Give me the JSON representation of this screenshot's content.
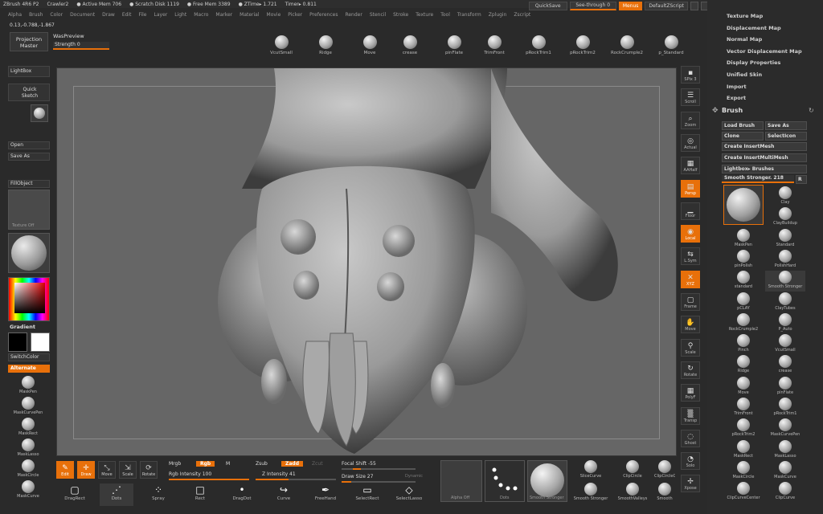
{
  "titlebar": {
    "app": "ZBrush 4R6 P2",
    "doc": "Crawler2",
    "mem": "● Active Mem 706",
    "scratch": "● Scratch Disk 1119",
    "free": "● Free Mem 3389",
    "ztimer": "● ZTime▸ 1.721",
    "timer": "Timer▸ 0.811"
  },
  "menus": [
    "Alpha",
    "Brush",
    "Color",
    "Document",
    "Draw",
    "Edit",
    "File",
    "Layer",
    "Light",
    "Macro",
    "Marker",
    "Material",
    "Movie",
    "Picker",
    "Preferences",
    "Render",
    "Stencil",
    "Stroke",
    "Texture",
    "Tool",
    "Transform",
    "Zplugin",
    "Zscript"
  ],
  "topright": {
    "quicksave": "QuickSave",
    "seethrough": "See-through",
    "seethrough_val": "0",
    "menus": "Menus",
    "script": "DefaultZScript"
  },
  "coords": "0.13,-0.788,-1.867",
  "projection": {
    "line1": "Projection",
    "line2": "Master"
  },
  "waspreview": "WasPreview",
  "strength": {
    "label": "Strength",
    "value": "0",
    "level": 0
  },
  "shelf": [
    "VcutSmall",
    "Ridge",
    "Move",
    "crease",
    "pinFlate",
    "TrimFront",
    "pRockTrim1",
    "pRockTrim2",
    "RockCrumple2",
    "p_Standard"
  ],
  "left": {
    "lightbox": "LightBox",
    "quicksketch1": "Quick",
    "quicksketch2": "Sketch",
    "open": "Open",
    "saveas": "Save As",
    "fillobject": "FillObject",
    "texture": "Texture Off",
    "gradient": "Gradient",
    "switchcolor": "SwitchColor",
    "alternate": "Alternate",
    "alphas": [
      "MaskPen",
      "MaskCurvePen",
      "MaskRect",
      "MaskLasso",
      "MaskCircle",
      "MaskCurve"
    ]
  },
  "rightshelf": [
    "SPix 3",
    "Scroll",
    "Zoom",
    "Actual",
    "AAHalf",
    "Persp",
    "Floor",
    "Local",
    "L.Sym",
    "XYZ",
    "Frame",
    "Move",
    "Scale",
    "Rotate",
    "PolyF",
    "Transp",
    "Ghost",
    "Solo",
    "Xpose"
  ],
  "rightshelf_spix_val": "3",
  "tray": {
    "menu": [
      "Texture Map",
      "Displacement Map",
      "Normal Map",
      "Vector Displacement Map",
      "Display Properties",
      "Unified Skin",
      "Import",
      "Export"
    ],
    "brush_title": "Brush",
    "load": "Load Brush",
    "save": "Save As",
    "clone": "Clone",
    "selecticon": "SelectIcon",
    "insertmesh": "Create InsertMesh",
    "insertmulti": "Create InsertMultiMesh",
    "lightboxbrushes": "Lightbox▸ Brushes",
    "current": "Smooth Stronger. 218",
    "current_r": "R",
    "brushes": [
      "Clay",
      "ClayBuildup",
      "MaskPen",
      "Standard",
      "pinPolish",
      "PolishHard",
      "standard",
      "Smooth Stronger",
      "pCLAY",
      "ClayTubes",
      "RockCrumple2",
      "P_Auto",
      "Pinch",
      "VcutSmall",
      "Ridge",
      "crease",
      "Move",
      "pinFlate",
      "TrimFront",
      "pRockTrim1",
      "pRockTrim2",
      "MaskCurvePen",
      "MaskRect",
      "MaskLasso",
      "MaskCircle",
      "MaskCurve",
      "ClipCurveCenter",
      "ClipCurve"
    ]
  },
  "bottom": {
    "edit": "Edit",
    "draw": "Draw",
    "move": "Move",
    "scale": "Scale",
    "rotate": "Rotate",
    "mrgb": "Mrgb",
    "rgb": "Rgb",
    "m": "M",
    "rgb_intensity": "Rgb Intensity 100",
    "rgb_intensity_level": 1.0,
    "zsub": "Zsub",
    "zadd": "Zadd",
    "zcut": "Zcut",
    "z_intensity": "Z Intensity 41",
    "z_intensity_level": 0.41,
    "focal": "Focal Shift -55",
    "drawsize": "Draw Size 27",
    "dynamic": "Dynamic",
    "alpha_off": "Alpha Off",
    "texture_label": "Dots",
    "material_label": "Smooth Stronger",
    "strokes": [
      "DragRect",
      "Dots",
      "Spray",
      "Rect",
      "DragDot",
      "Curve",
      "FreeHand",
      "SelectRect",
      "SelectLasso"
    ],
    "slice": "SliceCurve",
    "clipcircle": "ClipCircle",
    "clipcirclecenter": "ClipCircleC",
    "smoothstronger": "Smooth Stronger",
    "smoothvalleys": "SmoothValleys",
    "smooth2": "Smooth"
  },
  "colors": {
    "accent": "#e8700a",
    "bg": "#2a2a2a",
    "viewport": "#666666"
  }
}
